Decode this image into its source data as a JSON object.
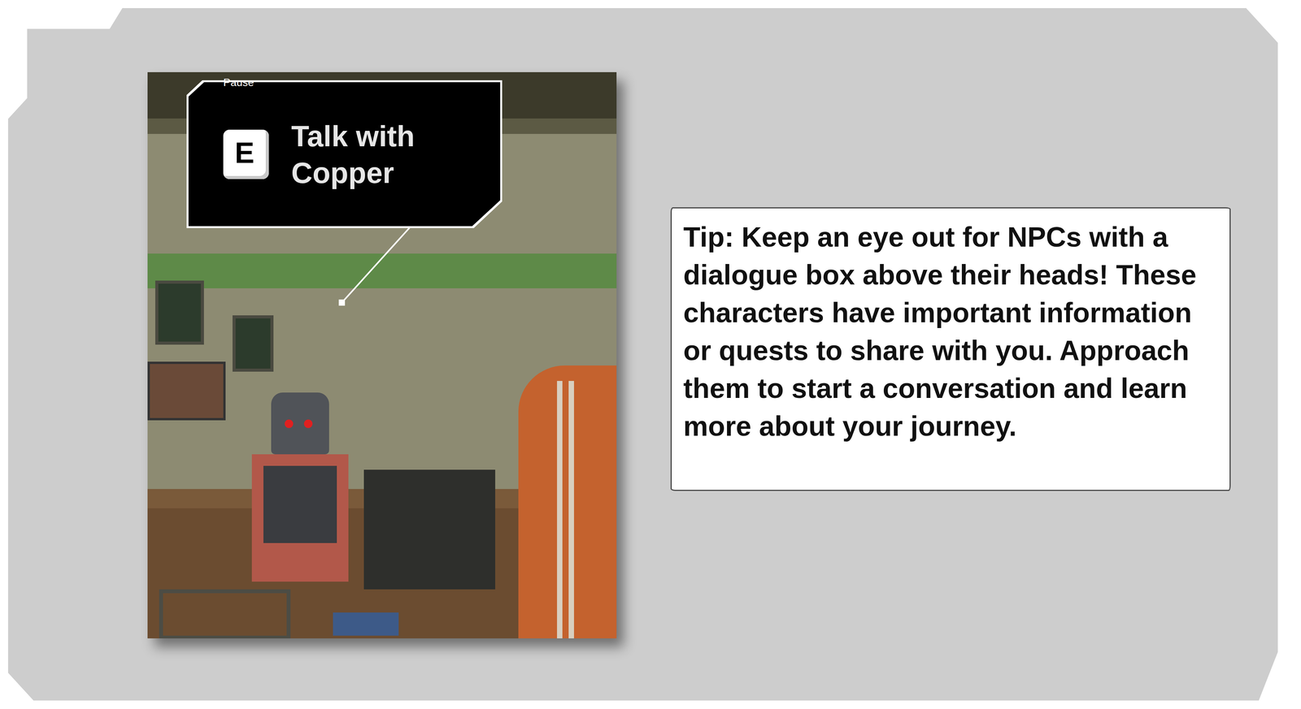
{
  "tutorial_card": {
    "screenshot": {
      "pause_label": "Pause",
      "prompt": {
        "key": "E",
        "action": "Talk with Copper"
      }
    },
    "tip": {
      "text": "Tip: Keep an eye out for NPCs with a dialogue box above their heads! These characters have important information or quests to share with you. Approach them to start a conversation and learn more about your journey."
    }
  }
}
